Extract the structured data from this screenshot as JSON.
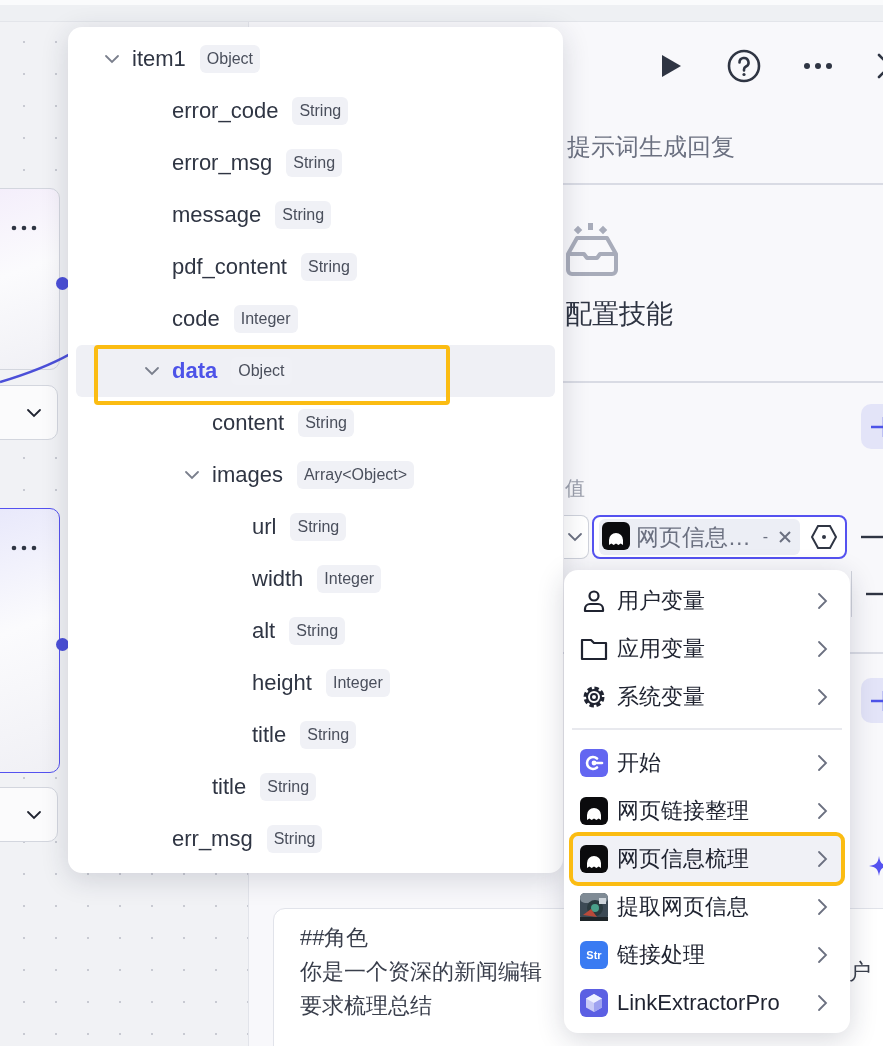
{
  "canvas": {
    "nodes": [
      {
        "selected": false
      },
      {
        "selected": true
      }
    ]
  },
  "panel": {
    "subtitle": "提示词生成回复",
    "skills_title": "配置技能",
    "value_label": "值",
    "variable_field": {
      "chip_label": "网页信息…",
      "chip_suffix": "-",
      "focused": true
    },
    "prompt_lines": [
      {
        "text": "##角色"
      },
      {
        "text": "你是一个资深的新闻编辑",
        "tail": "户"
      },
      {
        "text": "要求梳理总结"
      }
    ]
  },
  "tree": [
    {
      "name": "item1",
      "type": "Object",
      "expanded": true,
      "selected": false,
      "highlighted": false,
      "children": [
        {
          "name": "error_code",
          "type": "String",
          "selected": false,
          "highlighted": false
        },
        {
          "name": "error_msg",
          "type": "String",
          "selected": false,
          "highlighted": false
        },
        {
          "name": "message",
          "type": "String",
          "selected": false,
          "highlighted": false
        },
        {
          "name": "pdf_content",
          "type": "String",
          "selected": false,
          "highlighted": false
        },
        {
          "name": "code",
          "type": "Integer",
          "selected": false,
          "highlighted": false
        },
        {
          "name": "data",
          "type": "Object",
          "expanded": true,
          "selected": true,
          "highlighted": true,
          "children": [
            {
              "name": "content",
              "type": "String",
              "selected": false,
              "highlighted": false
            },
            {
              "name": "images",
              "type": "Array<Object>",
              "expanded": true,
              "selected": false,
              "highlighted": false,
              "children": [
                {
                  "name": "url",
                  "type": "String",
                  "selected": false,
                  "highlighted": false
                },
                {
                  "name": "width",
                  "type": "Integer",
                  "selected": false,
                  "highlighted": false
                },
                {
                  "name": "alt",
                  "type": "String",
                  "selected": false,
                  "highlighted": false
                },
                {
                  "name": "height",
                  "type": "Integer",
                  "selected": false,
                  "highlighted": false
                },
                {
                  "name": "title",
                  "type": "String",
                  "selected": false,
                  "highlighted": false
                }
              ]
            },
            {
              "name": "title",
              "type": "String",
              "selected": false,
              "highlighted": false
            }
          ]
        },
        {
          "name": "err_msg",
          "type": "String",
          "selected": false,
          "highlighted": false
        }
      ]
    }
  ],
  "menu": {
    "groups": [
      {
        "items": [
          {
            "label": "用户变量",
            "selected": false,
            "highlighted": false
          },
          {
            "label": "应用变量",
            "selected": false,
            "highlighted": false
          },
          {
            "label": "系统变量",
            "selected": false,
            "highlighted": false
          }
        ]
      },
      {
        "items": [
          {
            "label": "开始",
            "selected": false,
            "highlighted": false
          },
          {
            "label": "网页链接整理",
            "selected": false,
            "highlighted": false
          },
          {
            "label": "网页信息梳理",
            "selected": true,
            "highlighted": true
          },
          {
            "label": "提取网页信息",
            "selected": false,
            "highlighted": false
          },
          {
            "label": "链接处理",
            "icon_text": "Str",
            "selected": false,
            "highlighted": false
          },
          {
            "label": "LinkExtractorPro",
            "selected": false,
            "highlighted": false
          }
        ]
      }
    ]
  }
}
